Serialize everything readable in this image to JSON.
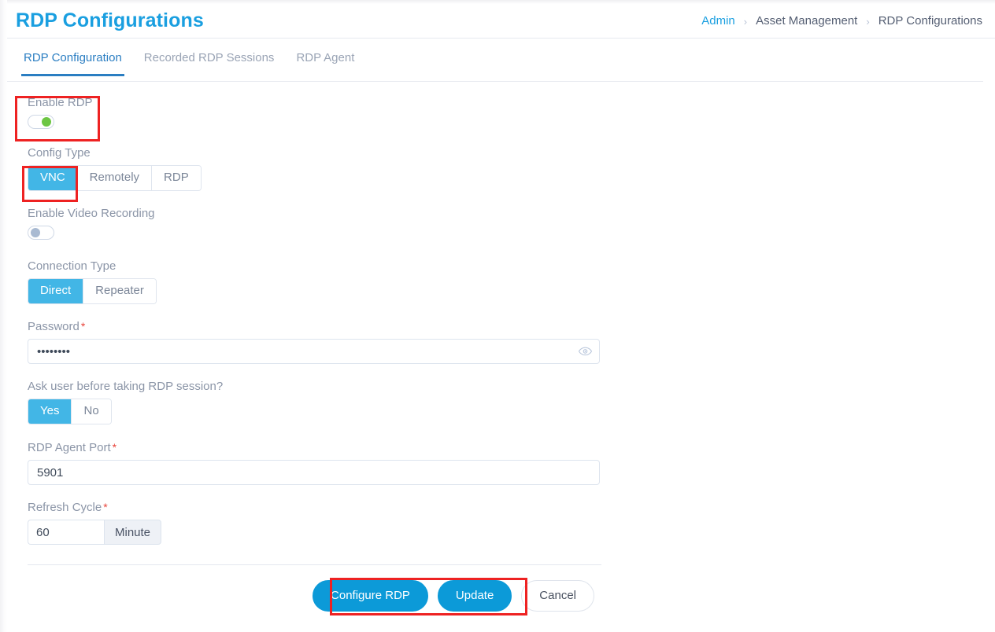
{
  "header": {
    "title": "RDP Configurations",
    "breadcrumb": [
      {
        "label": "Admin",
        "link": true
      },
      {
        "label": "Asset Management",
        "link": false
      },
      {
        "label": "RDP Configurations",
        "link": false
      }
    ],
    "separator": "›"
  },
  "tabs": [
    {
      "label": "RDP Configuration",
      "active": true
    },
    {
      "label": "Recorded RDP Sessions",
      "active": false
    },
    {
      "label": "RDP Agent",
      "active": false
    }
  ],
  "form": {
    "enable_rdp": {
      "label": "Enable RDP",
      "state": "on"
    },
    "config_type": {
      "label": "Config Type",
      "options": [
        "VNC",
        "Remotely",
        "RDP"
      ],
      "selected": "VNC"
    },
    "enable_video_recording": {
      "label": "Enable Video Recording",
      "state": "off"
    },
    "connection_type": {
      "label": "Connection Type",
      "options": [
        "Direct",
        "Repeater"
      ],
      "selected": "Direct"
    },
    "password": {
      "label": "Password",
      "required": "*",
      "value": "••••••••",
      "placeholder": "Password",
      "reveal_icon": "eye-icon"
    },
    "ask_user": {
      "label": "Ask user before taking RDP session?",
      "options": [
        "Yes",
        "No"
      ],
      "selected": "Yes"
    },
    "rdp_agent_port": {
      "label": "RDP Agent Port",
      "required": "*",
      "value": "5901",
      "placeholder": "RDP Agent Port"
    },
    "refresh_cycle": {
      "label": "Refresh Cycle",
      "required": "*",
      "value": "60",
      "placeholder": "Refresh Cycle",
      "unit": "Minute"
    }
  },
  "actions": {
    "configure": "Configure RDP",
    "update": "Update",
    "cancel": "Cancel"
  },
  "colors": {
    "title_blue": "#1a9fe0",
    "tab_active": "#2b7ec2",
    "segment_active": "#42b6e6",
    "button_primary": "#0c9ad8",
    "toggle_on": "#6dc644",
    "toggle_off": "#a9bad2",
    "required_star": "#e8453c",
    "highlight_box": "#ee2222"
  }
}
